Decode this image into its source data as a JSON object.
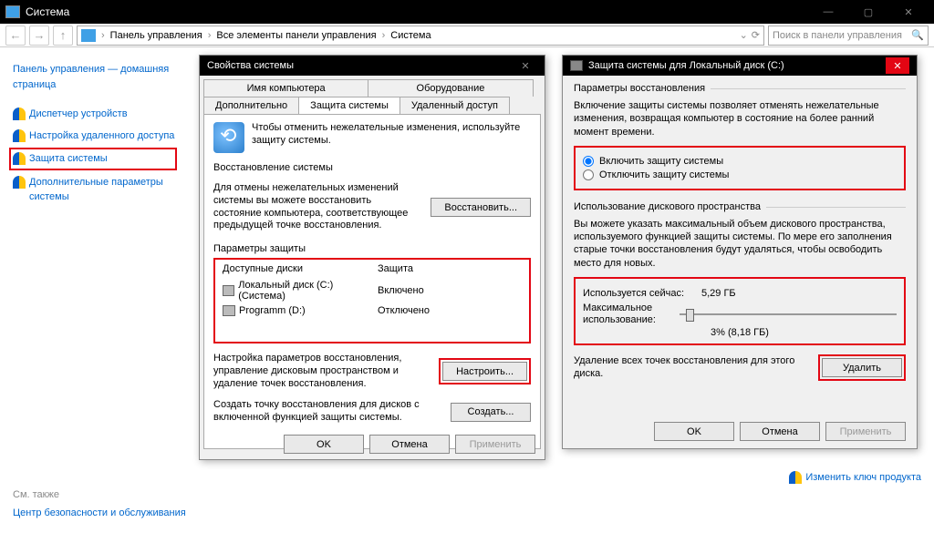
{
  "titlebar": {
    "title": "Система"
  },
  "nav": {
    "crumbs": [
      "Панель управления",
      "Все элементы панели управления",
      "Система"
    ],
    "search_placeholder": "Поиск в панели управления"
  },
  "sidebar": {
    "home": "Панель управления — домашняя страница",
    "items": [
      "Диспетчер устройств",
      "Настройка удаленного доступа",
      "Защита системы",
      "Дополнительные параметры системы"
    ],
    "seealso_label": "См. также",
    "seealso": "Центр безопасности и обслуживания"
  },
  "dlg1": {
    "title": "Свойства системы",
    "tabs": {
      "name": "Имя компьютера",
      "hardware": "Оборудование",
      "advanced": "Дополнительно",
      "protection": "Защита системы",
      "remote": "Удаленный доступ"
    },
    "intro": "Чтобы отменить нежелательные изменения, используйте защиту системы.",
    "restore_section": "Восстановление системы",
    "restore_desc": "Для отмены нежелательных изменений системы вы можете восстановить состояние компьютера, соответствующее предыдущей точке восстановления.",
    "restore_btn": "Восстановить...",
    "params_section": "Параметры защиты",
    "col_drives": "Доступные диски",
    "col_prot": "Защита",
    "drives": [
      {
        "name": "Локальный диск (C:) (Система)",
        "status": "Включено"
      },
      {
        "name": "Programm (D:)",
        "status": "Отключено"
      }
    ],
    "configure_desc": "Настройка параметров восстановления, управление дисковым пространством и удаление точек восстановления.",
    "configure_btn": "Настроить...",
    "create_desc": "Создать точку восстановления для дисков с включенной функцией защиты системы.",
    "create_btn": "Создать...",
    "ok": "OK",
    "cancel": "Отмена",
    "apply": "Применить"
  },
  "dlg2": {
    "title": "Защита системы для Локальный диск (C:)",
    "group_restore": "Параметры восстановления",
    "restore_para": "Включение защиты системы позволяет отменять нежелательные изменения, возвращая компьютер в состояние на более ранний момент времени.",
    "radio_on": "Включить защиту системы",
    "radio_off": "Отключить защиту системы",
    "group_usage": "Использование дискового пространства",
    "usage_para": "Вы можете указать максимальный объем дискового пространства, используемого функцией защиты системы. По мере его заполнения старые точки восстановления будут удаляться, чтобы освободить место для новых.",
    "used_label": "Используется сейчас:",
    "used_value": "5,29 ГБ",
    "max_label": "Максимальное использование:",
    "slider_value": "3% (8,18 ГБ)",
    "delete_desc": "Удаление всех точек восстановления для этого диска.",
    "delete_btn": "Удалить",
    "ok": "OK",
    "cancel": "Отмена",
    "apply": "Применить"
  },
  "footer": {
    "change_key": "Изменить ключ продукта"
  }
}
